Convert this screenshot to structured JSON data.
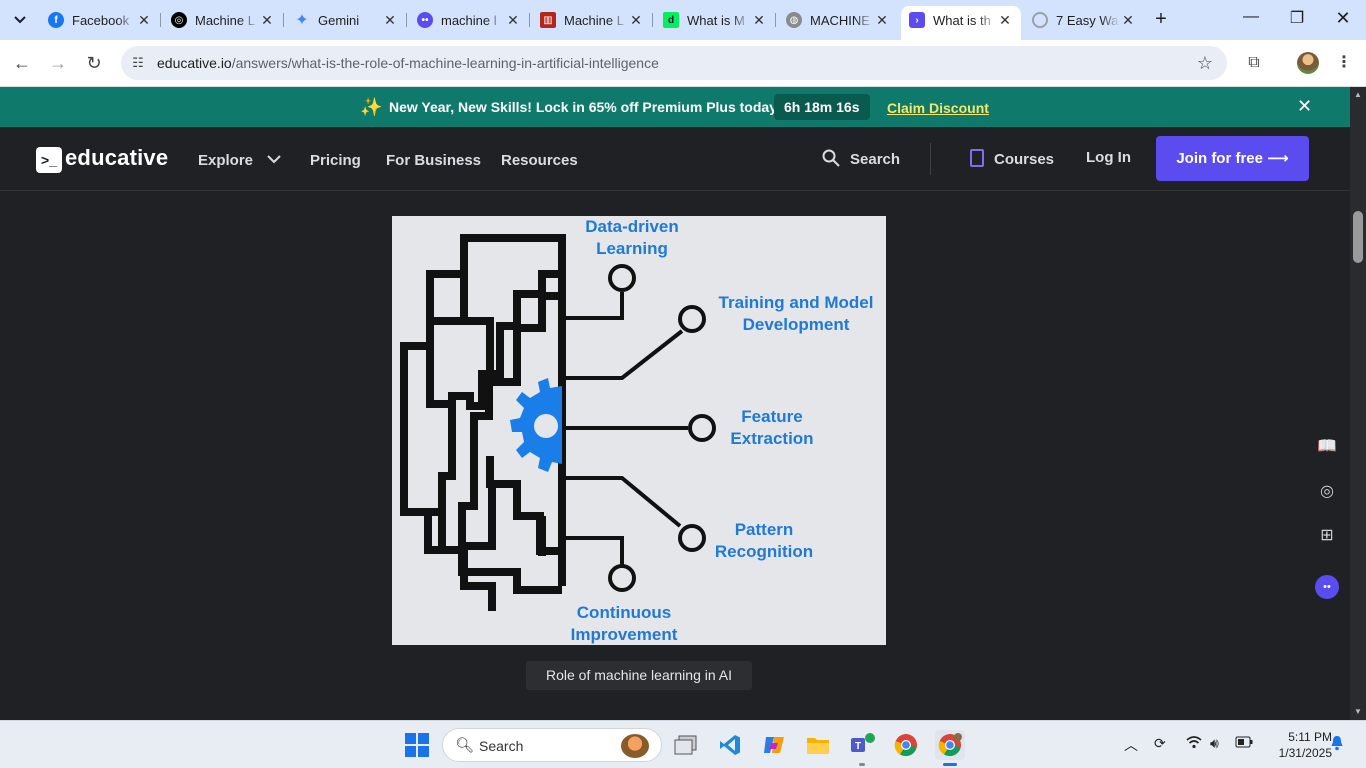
{
  "browser": {
    "tabs": [
      {
        "title": "Facebook",
        "icon": "facebook-icon",
        "color": "#1877f2"
      },
      {
        "title": "Machine L",
        "icon": "chatgpt-icon",
        "color": "#000000"
      },
      {
        "title": "Gemini",
        "icon": "gemini-icon",
        "color": "#4285f4"
      },
      {
        "title": "machine l",
        "icon": "copilot-icon",
        "color": "#5b4cf0"
      },
      {
        "title": "Machine L",
        "icon": "bank-icon",
        "color": "#b3261e"
      },
      {
        "title": "What is M",
        "icon": "datacamp-icon",
        "color": "#03ef62"
      },
      {
        "title": "MACHINE",
        "icon": "globe-icon",
        "color": "#8a8a8a"
      },
      {
        "title": "What is th",
        "icon": "educative-icon",
        "color": "#5b4cf0",
        "active": true
      },
      {
        "title": "7 Easy Wa",
        "icon": "loading-icon",
        "color": "#9aa0a6"
      }
    ],
    "url_domain": "educative.io",
    "url_path": "/answers/what-is-the-role-of-machine-learning-in-artificial-intelligence"
  },
  "promo": {
    "text": "New Year, New Skills! Lock in 65% off Premium Plus today.",
    "timer": "6h 18m 16s",
    "cta": "Claim Discount"
  },
  "header": {
    "logo": "educative",
    "nav": [
      "Explore",
      "Pricing",
      "For Business",
      "Resources"
    ],
    "search": "Search",
    "courses": "Courses",
    "login": "Log In",
    "join": "Join for free"
  },
  "figure": {
    "labels": {
      "data_driven": "Data-driven\nLearning",
      "training": "Training and Model\nDevelopment",
      "feature": "Feature\nExtraction",
      "pattern": "Pattern\nRecognition",
      "continuous": "Continuous\nImprovement"
    },
    "label_color": "#1f7ad6",
    "caption": "Role of machine learning in AI"
  },
  "taskbar": {
    "search": "Search",
    "time": "5:11 PM",
    "date": "1/31/2025"
  }
}
